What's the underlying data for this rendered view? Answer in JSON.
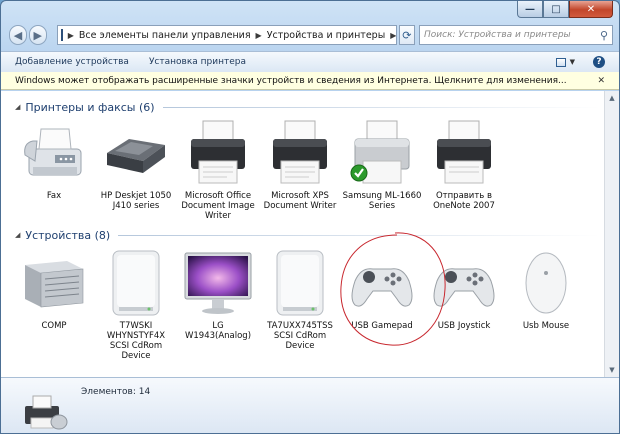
{
  "window": {
    "caption": {
      "minimize": "—",
      "maximize": "□",
      "close": "✕"
    }
  },
  "nav": {
    "back": "◀",
    "forward": "▶",
    "breadcrumbs": [
      "Все элементы панели управления",
      "Устройства и принтеры"
    ],
    "search_placeholder": "Поиск: Устройства и принтеры"
  },
  "command_bar": {
    "add_device": "Добавление устройства",
    "add_printer": "Установка принтера"
  },
  "info_bar": {
    "text": "Windows может отображать расширенные значки устройств и сведения из Интернета. Щелкните для изменения...",
    "close": "✕"
  },
  "sections": {
    "printers": {
      "title": "Принтеры и факсы (6)",
      "items": [
        {
          "label": "Fax",
          "icon": "fax-icon"
        },
        {
          "label": "HP Deskjet 1050 J410 series",
          "icon": "inkjet-printer-icon"
        },
        {
          "label": "Microsoft Office Document Image Writer",
          "icon": "printer-icon"
        },
        {
          "label": "Microsoft XPS Document Writer",
          "icon": "printer-icon"
        },
        {
          "label": "Samsung ML-1660 Series",
          "icon": "default-printer-icon"
        },
        {
          "label": "Отправить в OneNote 2007",
          "icon": "printer-icon"
        }
      ]
    },
    "devices": {
      "title": "Устройства (8)",
      "items": [
        {
          "label": "COMP",
          "icon": "computer-icon"
        },
        {
          "label": "T7WSKI WHYNSTYF4X SCSI CdRom Device",
          "icon": "cdrom-drive-icon"
        },
        {
          "label": "LG W1943(Analog)",
          "icon": "monitor-icon"
        },
        {
          "label": "TA7UXX745TSS SCSI CdRom Device",
          "icon": "cdrom-drive-icon"
        },
        {
          "label": "USB Gamepad",
          "icon": "gamepad-icon"
        },
        {
          "label": "USB Joystick",
          "icon": "gamepad-icon"
        },
        {
          "label": "Usb Mouse",
          "icon": "mouse-icon"
        }
      ]
    }
  },
  "status_bar": {
    "text": "Элементов: 14"
  },
  "colors": {
    "accent": "#1e3f6f",
    "annotation": "#c8282f"
  }
}
